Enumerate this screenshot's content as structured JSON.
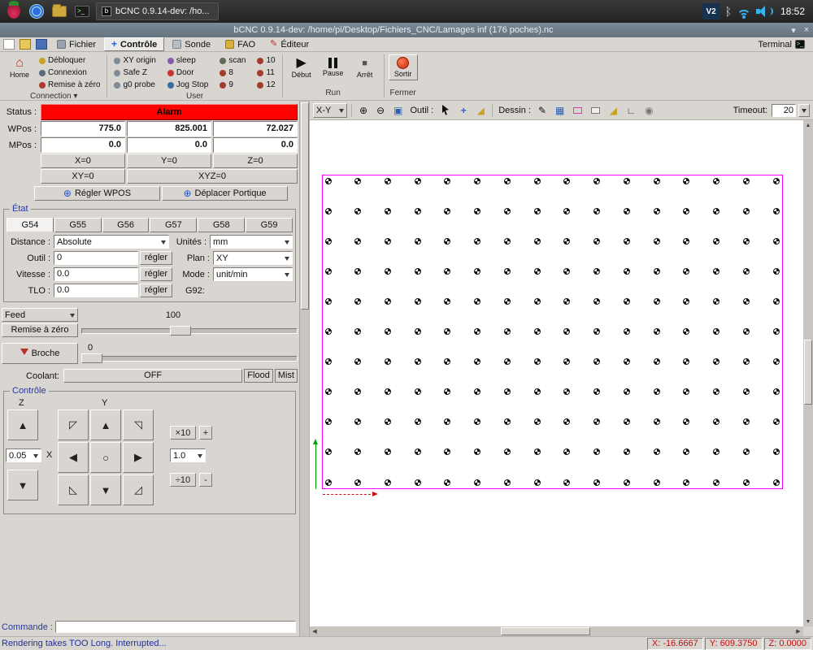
{
  "taskbar": {
    "window_button": "bCNC 0.9.14-dev: /ho...",
    "vnc": "V2",
    "time": "18:52"
  },
  "titlebar": {
    "title": "bCNC 0.9.14-dev: /home/pi/Desktop/Fichiers_CNC/Lamages inf (176 poches).nc"
  },
  "menubar": {
    "tabs": [
      {
        "label": "Fichier"
      },
      {
        "label": "Contrôle"
      },
      {
        "label": "Sonde"
      },
      {
        "label": "FAO"
      },
      {
        "label": "Éditeur"
      }
    ],
    "terminal": "Terminal"
  },
  "ribbon": {
    "home": "Home",
    "connection": [
      "Débloquer",
      "Connexion",
      "Remise à zéro"
    ],
    "connection_label": "Connection",
    "user_rows": [
      [
        "XY origin",
        "sleep",
        "scan",
        "10"
      ],
      [
        "Safe Z",
        "Door",
        "8",
        "11"
      ],
      [
        "g0 probe",
        "Jog Stop",
        "9",
        "12"
      ]
    ],
    "user_label": "User",
    "run": [
      "Début",
      "Pause",
      "Arrêt"
    ],
    "run_label": "Run",
    "sortir": "Sortir",
    "fermer_label": "Fermer"
  },
  "status": {
    "label": "Status :",
    "value": "Alarm",
    "wpos_label": "WPos :",
    "wpos": [
      "775.0",
      "825.001",
      "72.027"
    ],
    "mpos_label": "MPos :",
    "mpos": [
      "0.0",
      "0.0",
      "0.0"
    ],
    "zero": [
      "X=0",
      "Y=0",
      "Z=0"
    ],
    "xy0": "XY=0",
    "xyz0": "XYZ=0",
    "regler_wpos": "Régler WPOS",
    "deplacer": "Déplacer Portique"
  },
  "etat": {
    "title": "État",
    "gcodes": [
      "G54",
      "G55",
      "G56",
      "G57",
      "G58",
      "G59"
    ],
    "rows": {
      "distance_label": "Distance :",
      "distance": "Absolute",
      "unites_label": "Unités :",
      "unites": "mm",
      "outil_label": "Outil :",
      "outil": "0",
      "regler": "régler",
      "plan_label": "Plan :",
      "plan": "XY",
      "vitesse_label": "Vitesse :",
      "vitesse": "0.0",
      "mode_label": "Mode :",
      "mode": "unit/min",
      "tlo_label": "TLO :",
      "tlo": "0.0",
      "g92": "G92:"
    }
  },
  "feed": {
    "label": "Feed",
    "value": "100",
    "remise": "Remise à zéro",
    "broche": "Broche",
    "broche_value": "0",
    "coolant_label": "Coolant:",
    "coolant_value": "OFF",
    "flood": "Flood",
    "mist": "Mist"
  },
  "jog": {
    "title": "Contrôle",
    "z": "Z",
    "y": "Y",
    "x": "X",
    "step": "0.05",
    "feed_step": "1.0",
    "mul": "×10",
    "plus": "+",
    "div": "÷10",
    "minus": "-"
  },
  "commande": {
    "label": "Commande :",
    "value": ""
  },
  "canvas_toolbar": {
    "view": "X-Y",
    "outil_label": "Outil :",
    "dessin_label": "Dessin :",
    "timeout_label": "Timeout:",
    "timeout_value": "20"
  },
  "canvas": {
    "grid_cols": 16,
    "grid_rows": 11,
    "outline_color": "#ff00ff"
  },
  "statusbar": {
    "message": "Rendering takes TOO Long. Interrupted...",
    "x": "X: -16.6667",
    "y": "Y: 609.3750",
    "z": "Z: 0.0000"
  },
  "colors": {
    "alarm_bg": "#ff0000",
    "work_outline": "#ff00ff",
    "group_label": "#2438a6",
    "coord_text": "#c01010"
  },
  "icons": {
    "home": "⌂",
    "play": "▶",
    "stop": "■",
    "zoom_in": "⊕",
    "zoom_out": "⊖",
    "zoom_fit": "▣",
    "up": "▲",
    "down": "▼",
    "left": "◀",
    "right": "▶",
    "nw": "◸",
    "ne": "◹",
    "sw": "◺",
    "se": "◿",
    "center": "○",
    "plus_cross": "⊕",
    "gantry": "+",
    "ruler": "◢",
    "pen": "✎",
    "grid": "▦",
    "angle": "∟",
    "camera": "◉",
    "bluetooth": "ᛒ",
    "shade": "▾",
    "close": "×"
  }
}
